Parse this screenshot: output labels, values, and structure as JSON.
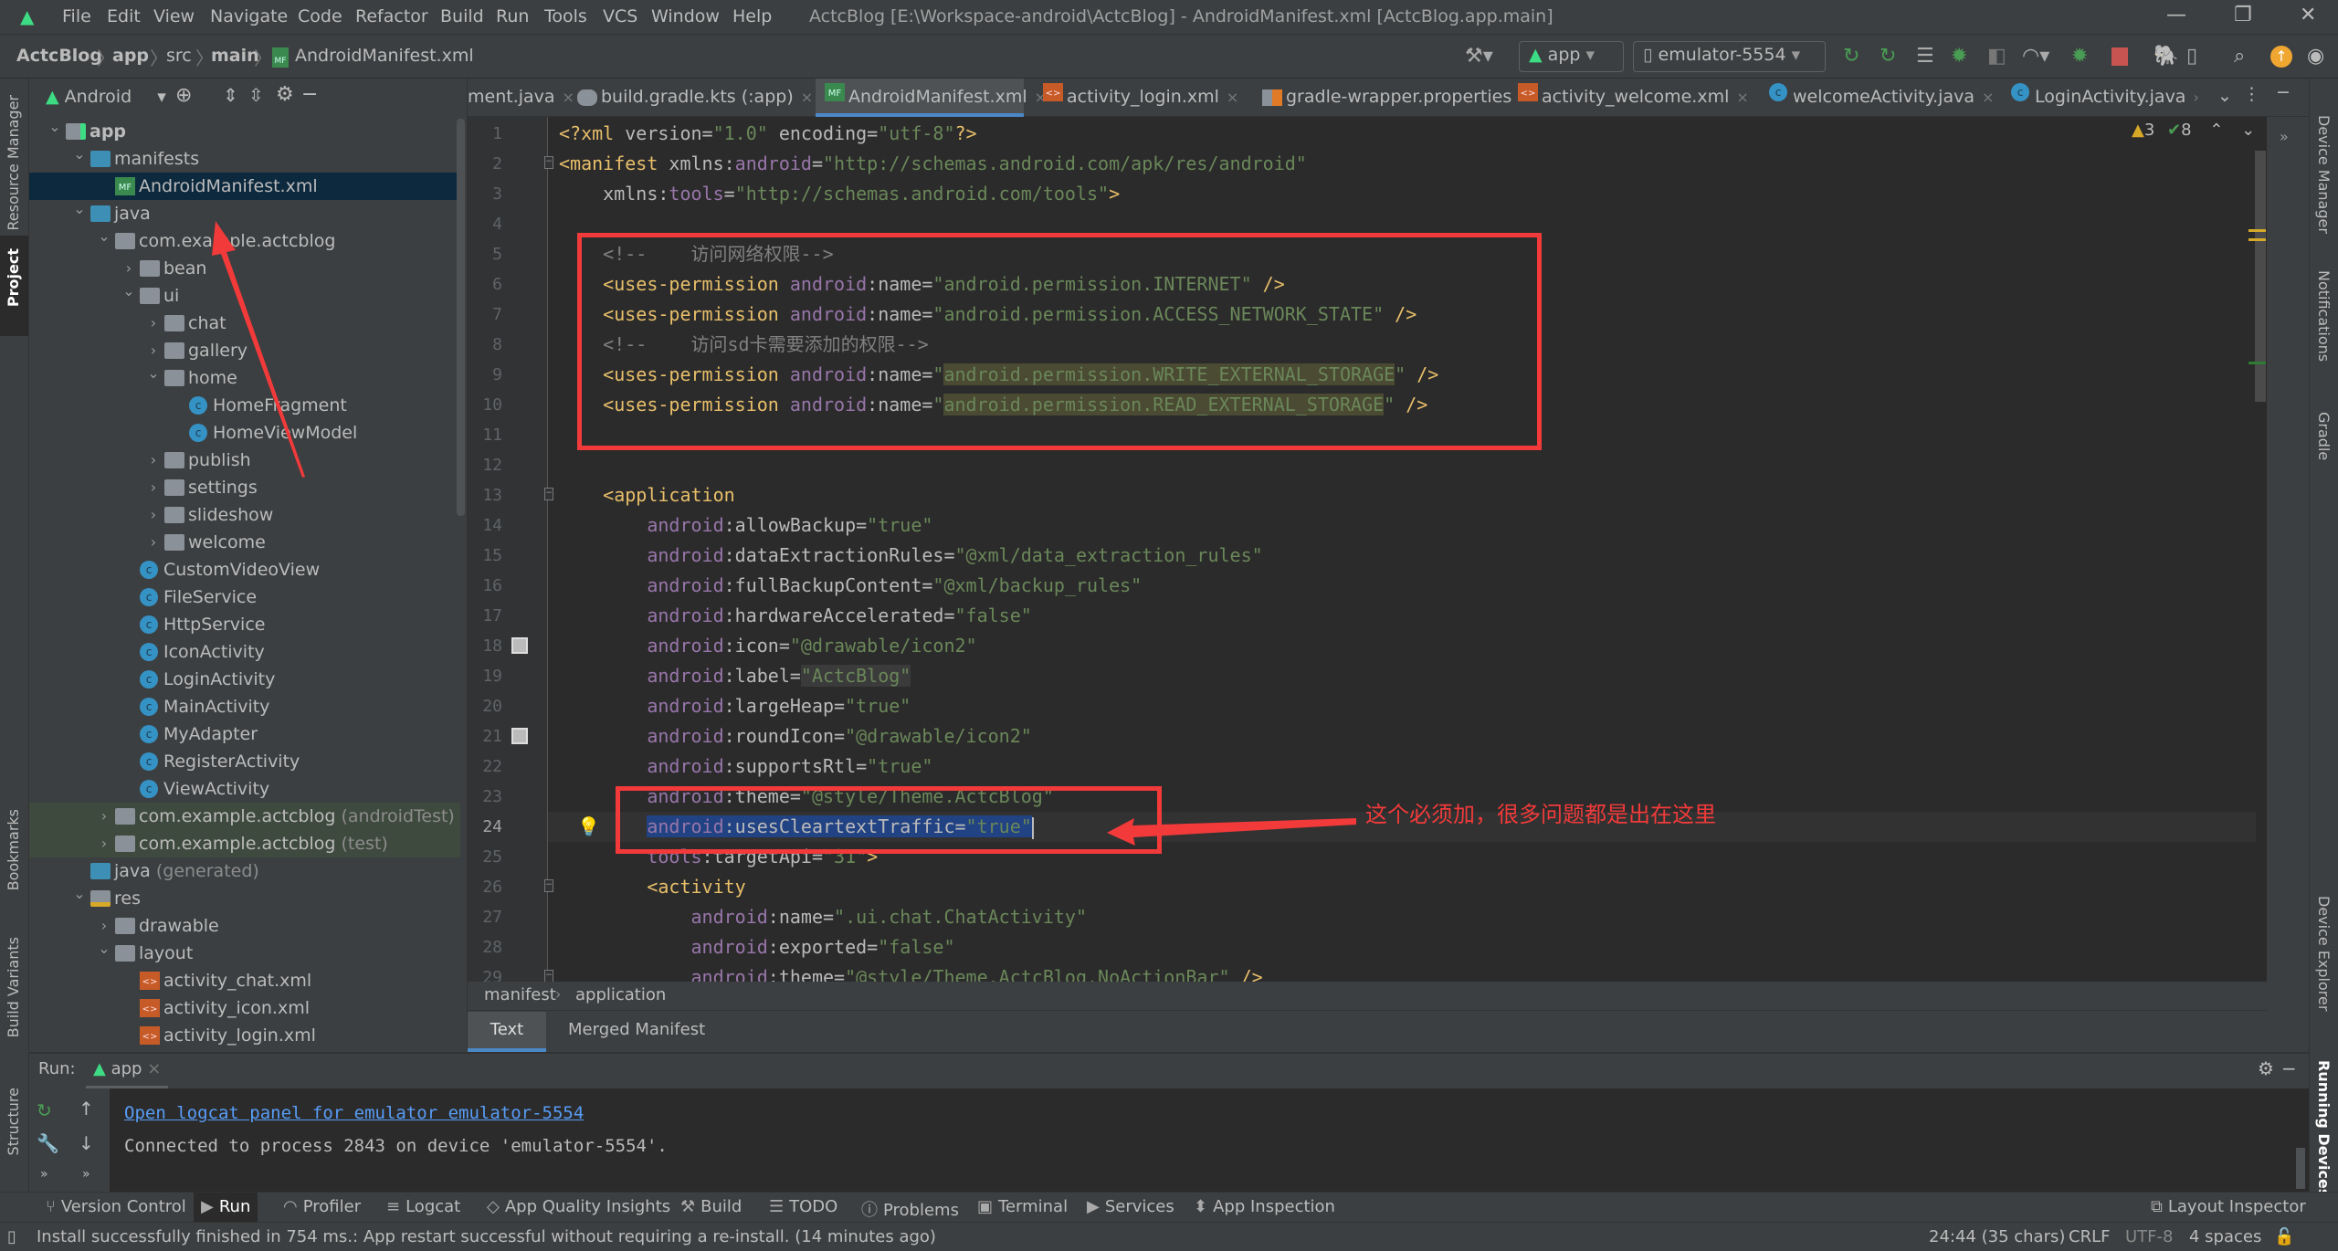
{
  "titlebar": {
    "menus": [
      "File",
      "Edit",
      "View",
      "Navigate",
      "Code",
      "Refactor",
      "Build",
      "Run",
      "Tools",
      "VCS",
      "Window",
      "Help"
    ],
    "title": "ActcBlog [E:\\Workspace-android\\ActcBlog] - AndroidManifest.xml [ActcBlog.app.main]"
  },
  "breadcrumb": [
    "ActcBlog",
    "app",
    "src",
    "main",
    "AndroidManifest.xml"
  ],
  "toolbar": {
    "run_config": "app",
    "device": "emulator-5554"
  },
  "project": {
    "view": "Android",
    "tree": [
      {
        "level": 0,
        "label": "app",
        "icon": "app-module",
        "exp": "open",
        "bold": true
      },
      {
        "level": 1,
        "label": "manifests",
        "icon": "folder-blue",
        "exp": "open"
      },
      {
        "level": 2,
        "label": "AndroidManifest.xml",
        "icon": "manifest",
        "selected": true
      },
      {
        "level": 1,
        "label": "java",
        "icon": "folder-blue",
        "exp": "open"
      },
      {
        "level": 2,
        "label": "com.example.actcblog",
        "icon": "package",
        "exp": "open"
      },
      {
        "level": 3,
        "label": "bean",
        "icon": "package",
        "exp": "closed"
      },
      {
        "level": 3,
        "label": "ui",
        "icon": "package",
        "exp": "open"
      },
      {
        "level": 4,
        "label": "chat",
        "icon": "package",
        "exp": "closed"
      },
      {
        "level": 4,
        "label": "gallery",
        "icon": "package",
        "exp": "closed"
      },
      {
        "level": 4,
        "label": "home",
        "icon": "package",
        "exp": "open"
      },
      {
        "level": 5,
        "label": "HomeFragment",
        "icon": "class"
      },
      {
        "level": 5,
        "label": "HomeViewModel",
        "icon": "class"
      },
      {
        "level": 4,
        "label": "publish",
        "icon": "package",
        "exp": "closed"
      },
      {
        "level": 4,
        "label": "settings",
        "icon": "package",
        "exp": "closed"
      },
      {
        "level": 4,
        "label": "slideshow",
        "icon": "package",
        "exp": "closed"
      },
      {
        "level": 4,
        "label": "welcome",
        "icon": "package",
        "exp": "closed"
      },
      {
        "level": 3,
        "label": "CustomVideoView",
        "icon": "class"
      },
      {
        "level": 3,
        "label": "FileService",
        "icon": "class"
      },
      {
        "level": 3,
        "label": "HttpService",
        "icon": "class"
      },
      {
        "level": 3,
        "label": "IconActivity",
        "icon": "class"
      },
      {
        "level": 3,
        "label": "LoginActivity",
        "icon": "class"
      },
      {
        "level": 3,
        "label": "MainActivity",
        "icon": "class"
      },
      {
        "level": 3,
        "label": "MyAdapter",
        "icon": "class"
      },
      {
        "level": 3,
        "label": "RegisterActivity",
        "icon": "class"
      },
      {
        "level": 3,
        "label": "ViewActivity",
        "icon": "class"
      },
      {
        "level": 2,
        "label": "com.example.actcblog",
        "suffix": "(androidTest)",
        "icon": "package",
        "exp": "closed",
        "test": true
      },
      {
        "level": 2,
        "label": "com.example.actcblog",
        "suffix": "(test)",
        "icon": "package",
        "exp": "closed",
        "test": true
      },
      {
        "level": 1,
        "label": "java",
        "suffix": "(generated)",
        "icon": "java-generated"
      },
      {
        "level": 1,
        "label": "res",
        "icon": "res-folder",
        "exp": "open"
      },
      {
        "level": 2,
        "label": "drawable",
        "icon": "package",
        "exp": "closed"
      },
      {
        "level": 2,
        "label": "layout",
        "icon": "package",
        "exp": "open"
      },
      {
        "level": 3,
        "label": "activity_chat.xml",
        "icon": "layout-xml"
      },
      {
        "level": 3,
        "label": "activity_icon.xml",
        "icon": "layout-xml"
      },
      {
        "level": 3,
        "label": "activity_login.xml",
        "icon": "layout-xml"
      }
    ]
  },
  "left_tools": [
    "Resource Manager",
    "Project",
    "Bookmarks",
    "Build Variants",
    "Structure"
  ],
  "right_tools": [
    "Device Manager",
    "Notifications",
    "Gradle",
    "Device Explorer",
    "Running Devices"
  ],
  "tabs": [
    {
      "label": "ment.java",
      "icon": "none"
    },
    {
      "label": "build.gradle.kts (:app)",
      "icon": "gradle"
    },
    {
      "label": "AndroidManifest.xml",
      "icon": "manifest",
      "active": true
    },
    {
      "label": "activity_login.xml",
      "icon": "layout-xml"
    },
    {
      "label": "gradle-wrapper.properties",
      "icon": "properties"
    },
    {
      "label": "activity_welcome.xml",
      "icon": "layout-xml"
    },
    {
      "label": "welcomeActivity.java",
      "icon": "class"
    },
    {
      "label": "LoginActivity.java",
      "icon": "class",
      "noclose": true
    }
  ],
  "inspections": {
    "warnings": "3",
    "typos": "8"
  },
  "editor": {
    "current_line": 24,
    "lines": [
      [
        [
          "t",
          "<?xml "
        ],
        [
          "a",
          "version="
        ],
        [
          "v",
          "\"1.0\""
        ],
        [
          "a",
          " encoding="
        ],
        [
          "v",
          "\"utf-8\""
        ],
        [
          "t",
          "?>"
        ]
      ],
      [
        [
          "t",
          "<manifest "
        ],
        [
          "a",
          "xmlns:"
        ],
        [
          "n",
          "android"
        ],
        [
          "a",
          "="
        ],
        [
          "v",
          "\"http://schemas.android.com/apk/res/android\""
        ]
      ],
      [
        [
          "p",
          "    "
        ],
        [
          "a",
          "xmlns:"
        ],
        [
          "n",
          "tools"
        ],
        [
          "a",
          "="
        ],
        [
          "v",
          "\"http://schemas.android.com/tools\""
        ],
        [
          "t",
          ">"
        ]
      ],
      [],
      [
        [
          "p",
          "    "
        ],
        [
          "c",
          "<!--    访问网络权限-->"
        ]
      ],
      [
        [
          "p",
          "    "
        ],
        [
          "t",
          "<uses-permission "
        ],
        [
          "n",
          "android"
        ],
        [
          "a",
          ":name="
        ],
        [
          "v",
          "\"android.permission.INTERNET\""
        ],
        [
          "t",
          " />"
        ]
      ],
      [
        [
          "p",
          "    "
        ],
        [
          "t",
          "<uses-permission "
        ],
        [
          "n",
          "android"
        ],
        [
          "a",
          ":name="
        ],
        [
          "v",
          "\"android.permission.ACCESS_NETWORK_STATE\""
        ],
        [
          "t",
          " />"
        ]
      ],
      [
        [
          "p",
          "    "
        ],
        [
          "c",
          "<!--    访问sd卡需要添加的权限-->"
        ]
      ],
      [
        [
          "p",
          "    "
        ],
        [
          "t",
          "<uses-permission "
        ],
        [
          "n",
          "android"
        ],
        [
          "a",
          ":name="
        ],
        [
          "v",
          "\""
        ],
        [
          "v",
          "android.permission.WRITE_EXTERNAL_STORAGE",
          "hl"
        ],
        [
          "v",
          "\""
        ],
        [
          "t",
          " />"
        ]
      ],
      [
        [
          "p",
          "    "
        ],
        [
          "t",
          "<uses-permission "
        ],
        [
          "n",
          "android"
        ],
        [
          "a",
          ":name="
        ],
        [
          "v",
          "\""
        ],
        [
          "v",
          "android.permission.READ_EXTERNAL_STORAGE",
          "hl"
        ],
        [
          "v",
          "\""
        ],
        [
          "t",
          " />"
        ]
      ],
      [],
      [],
      [
        [
          "p",
          "    "
        ],
        [
          "t",
          "<application"
        ]
      ],
      [
        [
          "p",
          "        "
        ],
        [
          "n",
          "android"
        ],
        [
          "a",
          ":allowBackup="
        ],
        [
          "v",
          "\"true\""
        ]
      ],
      [
        [
          "p",
          "        "
        ],
        [
          "n",
          "android"
        ],
        [
          "a",
          ":dataExtractionRules="
        ],
        [
          "v",
          "\"@xml/data_extraction_rules\""
        ]
      ],
      [
        [
          "p",
          "        "
        ],
        [
          "n",
          "android"
        ],
        [
          "a",
          ":fullBackupContent="
        ],
        [
          "v",
          "\"@xml/backup_rules\""
        ]
      ],
      [
        [
          "p",
          "        "
        ],
        [
          "n",
          "android"
        ],
        [
          "a",
          ":hardwareAccelerated="
        ],
        [
          "v",
          "\"false\""
        ]
      ],
      [
        [
          "p",
          "        "
        ],
        [
          "n",
          "android"
        ],
        [
          "a",
          ":icon="
        ],
        [
          "v",
          "\"@drawable/icon2\""
        ]
      ],
      [
        [
          "p",
          "        "
        ],
        [
          "n",
          "android"
        ],
        [
          "a",
          ":label="
        ],
        [
          "v",
          "\"ActcBlog\"",
          "hl2"
        ]
      ],
      [
        [
          "p",
          "        "
        ],
        [
          "n",
          "android"
        ],
        [
          "a",
          ":largeHeap="
        ],
        [
          "v",
          "\"true\""
        ]
      ],
      [
        [
          "p",
          "        "
        ],
        [
          "n",
          "android"
        ],
        [
          "a",
          ":roundIcon="
        ],
        [
          "v",
          "\"@drawable/icon2\""
        ]
      ],
      [
        [
          "p",
          "        "
        ],
        [
          "n",
          "android"
        ],
        [
          "a",
          ":supportsRtl="
        ],
        [
          "v",
          "\"true\""
        ]
      ],
      [
        [
          "p",
          "        "
        ],
        [
          "n",
          "android"
        ],
        [
          "a",
          ":theme="
        ],
        [
          "v",
          "\"@style/Theme.ActcBlog\""
        ]
      ],
      [
        [
          "p",
          "        "
        ],
        [
          "n",
          "android",
          "selx"
        ],
        [
          "a",
          ":usesCleartextTraffic=",
          "selx"
        ],
        [
          "v",
          "\"true\"",
          "selx"
        ]
      ],
      [
        [
          "p",
          "        "
        ],
        [
          "n",
          "tools"
        ],
        [
          "a",
          ":targetApi="
        ],
        [
          "v",
          "\"31\""
        ],
        [
          "t",
          ">"
        ]
      ],
      [
        [
          "p",
          "        "
        ],
        [
          "t",
          "<activity"
        ]
      ],
      [
        [
          "p",
          "            "
        ],
        [
          "n",
          "android"
        ],
        [
          "a",
          ":name="
        ],
        [
          "v",
          "\".ui.chat.ChatActivity\""
        ]
      ],
      [
        [
          "p",
          "            "
        ],
        [
          "n",
          "android"
        ],
        [
          "a",
          ":exported="
        ],
        [
          "v",
          "\"false\""
        ]
      ],
      [
        [
          "p",
          "            "
        ],
        [
          "n",
          "android"
        ],
        [
          "a",
          ":theme="
        ],
        [
          "v",
          "\"@style/Theme.ActcBlog.NoActionBar\""
        ],
        [
          "t",
          " />"
        ]
      ]
    ]
  },
  "editor_footer": {
    "path": [
      "manifest",
      "application"
    ],
    "tabs": [
      "Text",
      "Merged Manifest"
    ],
    "active_tab": "Text"
  },
  "annotation": {
    "note": "这个必须加，很多问题都是出在这里",
    "color": "#f23a3a"
  },
  "run": {
    "label": "Run:",
    "tab": "app",
    "link": "Open logcat panel for emulator emulator-5554",
    "message": "Connected to process 2843 on device 'emulator-5554'."
  },
  "toolwindows": [
    "Version Control",
    "Run",
    "Profiler",
    "Logcat",
    "App Quality Insights",
    "Build",
    "TODO",
    "Problems",
    "Terminal",
    "Services",
    "App Inspection"
  ],
  "toolwindow_active": "Run",
  "layout_inspector": "Layout Inspector",
  "status": {
    "message": "Install successfully finished in 754 ms.: App restart successful without requiring a re-install. (14 minutes ago)",
    "position": "24:44 (35 chars)",
    "line_sep": "CRLF",
    "encoding": "UTF-8",
    "indent": "4 spaces"
  },
  "colors": {
    "accent": "#4a88c7",
    "selection": "#214283",
    "annotation": "#f23a3a",
    "link": "#589df6"
  }
}
